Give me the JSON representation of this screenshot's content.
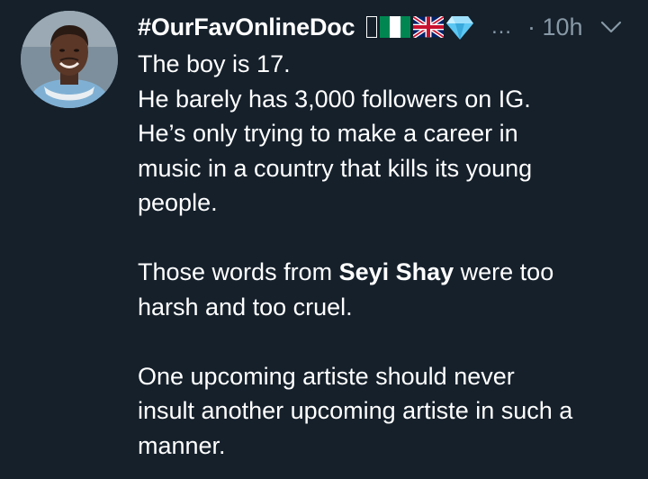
{
  "tweet": {
    "author": {
      "display_name": "#OurFavOnlineDoc",
      "badges": [
        "box-glyph",
        "nigeria-flag-emoji",
        "uk-flag-emoji",
        "gem-emoji"
      ]
    },
    "ellipsis": "…",
    "timestamp": "· 10h",
    "menu_icon": "chevron-down-icon",
    "paragraphs": {
      "p1": {
        "l1": "The boy is 17.",
        "l2": "He barely has 3,000 followers on IG.",
        "l3": "He’s only trying to make a career in",
        "l4": "music in a country that kills its young",
        "l5": "people."
      },
      "p2": {
        "l1_pre": "Those words from ",
        "l1_bold": "Seyi Shay",
        "l1_post": " were too",
        "l2": "harsh and too cruel."
      },
      "p3": {
        "l1": "One upcoming artiste should never",
        "l2": "insult another upcoming artiste in such a",
        "l3": "manner."
      }
    }
  },
  "colors": {
    "background": "#15202b",
    "text": "#ffffff",
    "secondary_text": "#8899a6",
    "nigeria_green": "#008751",
    "gem_blue": "#5cc7f2"
  }
}
